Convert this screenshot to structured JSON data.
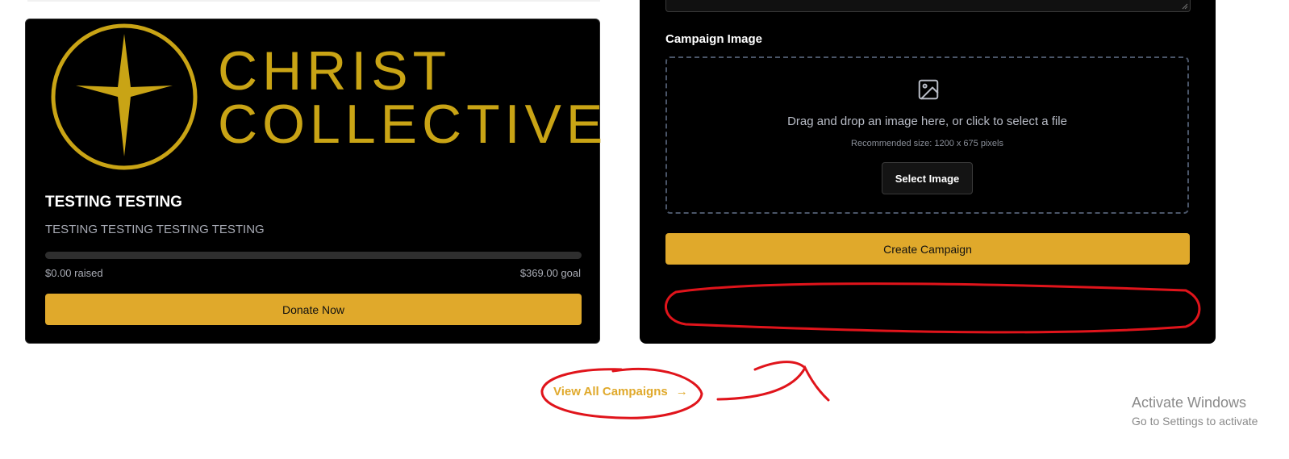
{
  "campaign_card": {
    "brand_line1": "CHRIST",
    "brand_line2": "COLLECTIVE",
    "title": "TESTING TESTING",
    "description": "TESTING TESTING TESTING TESTING",
    "progress_fraction": 0,
    "raised": "$0.00 raised",
    "goal": "$369.00 goal",
    "donate_label": "Donate Now"
  },
  "create_form": {
    "image_label": "Campaign Image",
    "dropzone_text": "Drag and drop an image here, or click to select a file",
    "dropzone_hint": "Recommended size: 1200 x 675 pixels",
    "select_image_label": "Select Image",
    "create_label": "Create Campaign"
  },
  "footer": {
    "view_all_label": "View All Campaigns",
    "view_all_arrow": "→"
  },
  "windows_watermark": {
    "title": "Activate Windows",
    "subtitle": "Go to Settings to activate"
  },
  "colors": {
    "gold": "#e0a92b",
    "logo_gold": "#c9a415",
    "panel_bg": "#000000",
    "annotation_red": "#e0141b"
  },
  "icons": [
    "four-point-star-icon",
    "image-icon",
    "resize-grip-icon",
    "arrow-right-icon"
  ]
}
